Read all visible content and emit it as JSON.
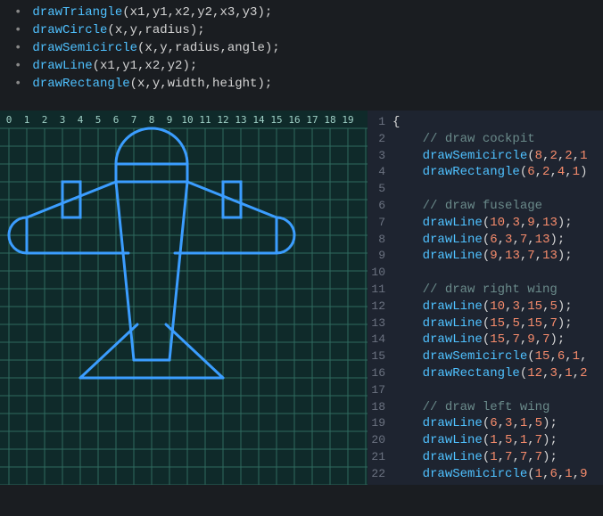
{
  "api": {
    "items": [
      {
        "fn": "drawTriangle",
        "sig": "(x1,y1,x2,y2,x3,y3);"
      },
      {
        "fn": "drawCircle",
        "sig": "(x,y,radius);"
      },
      {
        "fn": "drawSemicircle",
        "sig": "(x,y,radius,angle);"
      },
      {
        "fn": "drawLine",
        "sig": "(x1,y1,x2,y2);"
      },
      {
        "fn": "drawRectangle",
        "sig": "(x,y,width,height);"
      }
    ]
  },
  "canvas": {
    "ruler": [
      "0",
      "1",
      "2",
      "3",
      "4",
      "5",
      "6",
      "7",
      "8",
      "9",
      "10",
      "11",
      "12",
      "13",
      "14",
      "15",
      "16",
      "17",
      "18",
      "19"
    ],
    "cell": 20
  },
  "code": {
    "lines": [
      {
        "n": 1,
        "type": "brace",
        "text": "{"
      },
      {
        "n": 2,
        "type": "comment",
        "text": "// draw cockpit"
      },
      {
        "n": 3,
        "type": "call",
        "fn": "drawSemicircle",
        "args": "8,2,2,1"
      },
      {
        "n": 4,
        "type": "call",
        "fn": "drawRectangle",
        "args": "6,2,4,1)"
      },
      {
        "n": 5,
        "type": "blank",
        "text": ""
      },
      {
        "n": 6,
        "type": "comment",
        "text": "// draw fuselage"
      },
      {
        "n": 7,
        "type": "call",
        "fn": "drawLine",
        "args": "10,3,9,13);"
      },
      {
        "n": 8,
        "type": "call",
        "fn": "drawLine",
        "args": "6,3,7,13);"
      },
      {
        "n": 9,
        "type": "call",
        "fn": "drawLine",
        "args": "9,13,7,13);"
      },
      {
        "n": 10,
        "type": "blank",
        "text": ""
      },
      {
        "n": 11,
        "type": "comment",
        "text": "// draw right wing"
      },
      {
        "n": 12,
        "type": "call",
        "fn": "drawLine",
        "args": "10,3,15,5);"
      },
      {
        "n": 13,
        "type": "call",
        "fn": "drawLine",
        "args": "15,5,15,7);"
      },
      {
        "n": 14,
        "type": "call",
        "fn": "drawLine",
        "args": "15,7,9,7);"
      },
      {
        "n": 15,
        "type": "call",
        "fn": "drawSemicircle",
        "args": "15,6,1,"
      },
      {
        "n": 16,
        "type": "call",
        "fn": "drawRectangle",
        "args": "12,3,1,2"
      },
      {
        "n": 17,
        "type": "blank",
        "text": ""
      },
      {
        "n": 18,
        "type": "comment",
        "text": "// draw left wing"
      },
      {
        "n": 19,
        "type": "call",
        "fn": "drawLine",
        "args": "6,3,1,5);"
      },
      {
        "n": 20,
        "type": "call",
        "fn": "drawLine",
        "args": "1,5,1,7);"
      },
      {
        "n": 21,
        "type": "call",
        "fn": "drawLine",
        "args": "1,7,7,7);"
      },
      {
        "n": 22,
        "type": "call",
        "fn": "drawSemicircle",
        "args": "1,6,1,9"
      }
    ]
  }
}
